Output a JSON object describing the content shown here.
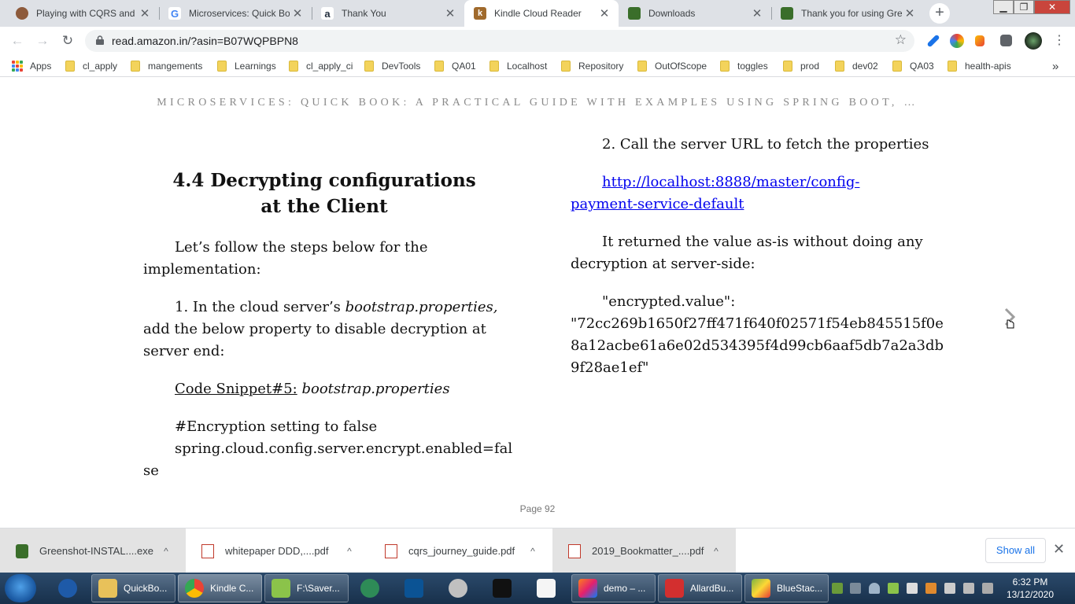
{
  "browser": {
    "tabs": [
      {
        "title": "Playing with CQRS and E",
        "icon": "avatar-favicon-icon",
        "color": "#8d5a3b"
      },
      {
        "title": "Microservices: Quick Boo",
        "icon": "google-favicon-icon",
        "color": "#4285f4"
      },
      {
        "title": "Thank You",
        "icon": "amazon-favicon-icon",
        "color": "#232f3e"
      },
      {
        "title": "Kindle Cloud Reader",
        "icon": "kindle-favicon-icon",
        "color": "#a06a2c"
      },
      {
        "title": "Downloads",
        "icon": "greenshot-favicon-icon",
        "color": "#3a6e2a"
      },
      {
        "title": "Thank you for using Gre",
        "icon": "greenshot-favicon-icon",
        "color": "#3a6e2a"
      }
    ],
    "tab_close": "✕",
    "new_tab": "+",
    "window_controls": {
      "minimize": "▁",
      "maximize": "❐",
      "close": "✕"
    },
    "url": "read.amazon.in/?asin=B07WQPBPN8",
    "bookmarks": {
      "apps_label": "Apps",
      "folders": [
        "cl_apply",
        "mangements",
        "Learnings",
        "cl_apply_ci",
        "DevTools",
        "QA01",
        "Localhost",
        "Repository",
        "OutOfScope",
        "toggles",
        "prod",
        "dev02",
        "QA03",
        "health-apis"
      ],
      "more": "»"
    }
  },
  "reader": {
    "book_title": "MICROSERVICES: QUICK BOOK: A PRACTICAL GUIDE WITH EXAMPLES USING SPRING BOOT, …",
    "heading_line1": "4.4 Decrypting configurations",
    "heading_line2": "at the Client",
    "left": {
      "intro": "Let’s follow the steps below for the implementation:",
      "step1_prefix": "1. In the cloud server’s ",
      "step1_italic": "bootstrap.properties,",
      "step1_suffix": " add the below property to disable decryption at server end:",
      "snippet_label": "Code Snippet#5:",
      "snippet_file": "bootstrap.properties",
      "code_comment": "#Encryption setting to false",
      "code_line": "spring.cloud.config.server.encrypt.enabled=fal",
      "code_wrap": "se"
    },
    "right": {
      "step2": "2. Call the server URL to fetch the properties",
      "url_line1": "http://localhost:8888/master/config-",
      "url_line2": "payment-service-default",
      "returned": "It returned the value as-is without doing any decryption at server-side:",
      "encrypted_key": "\"encrypted.value\":",
      "encrypted_line1": "\"72cc269b1650f27ff471f640f02571f54eb845515f0e",
      "encrypted_line2": "8a12acbe61a6e02d534395f4d99cb6aaf5db7a2a3db",
      "encrypted_line3": "9f28ae1ef\""
    },
    "page_label": "Page 92"
  },
  "downloads": {
    "items": [
      {
        "name": "Greenshot-INSTAL....exe",
        "icon": "installer-icon"
      },
      {
        "name": "whitepaper DDD,....pdf",
        "icon": "pdf-icon"
      },
      {
        "name": "cqrs_journey_guide.pdf",
        "icon": "pdf-icon"
      },
      {
        "name": "2019_Bookmatter_....pdf",
        "icon": "pdf-icon"
      }
    ],
    "chevron": "^",
    "show_all": "Show all",
    "close": "✕"
  },
  "taskbar": {
    "pinned": [
      {
        "label": "QuickBo...",
        "icon": "folder-icon"
      },
      {
        "label": "Kindle C...",
        "icon": "chrome-icon"
      },
      {
        "label": "F:\\Saver...",
        "icon": "notepad-icon"
      },
      {
        "label": "",
        "icon": "clock-app-icon"
      },
      {
        "label": "",
        "icon": "editor-app-icon"
      },
      {
        "label": "",
        "icon": "snipping-tool-icon"
      },
      {
        "label": "",
        "icon": "terminal-icon"
      },
      {
        "label": "",
        "icon": "document-app-icon"
      },
      {
        "label": "demo – ...",
        "icon": "intellij-icon"
      },
      {
        "label": "AllardBu...",
        "icon": "acrobat-icon"
      },
      {
        "label": "BlueStac...",
        "icon": "bluestacks-icon"
      }
    ],
    "time": "6:32 PM",
    "date": "13/12/2020"
  }
}
